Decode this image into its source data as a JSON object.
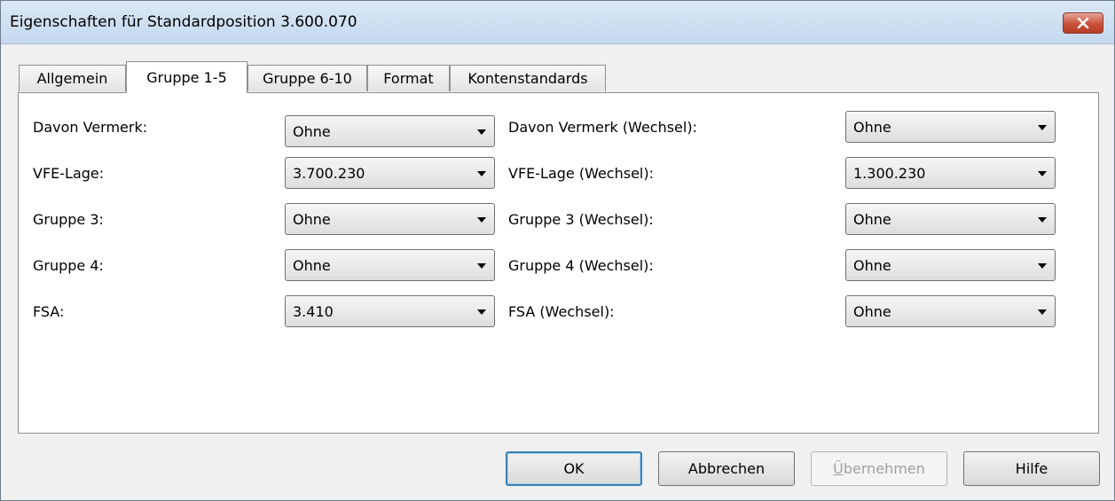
{
  "window": {
    "title": "Eigenschaften für Standardposition 3.600.070"
  },
  "tabs": [
    {
      "label": "Allgemein",
      "active": false
    },
    {
      "label": "Gruppe 1-5",
      "active": true
    },
    {
      "label": "Gruppe 6-10",
      "active": false
    },
    {
      "label": "Format",
      "active": false
    },
    {
      "label": "Kontenstandards",
      "active": false
    }
  ],
  "left_fields": [
    {
      "label": "Davon Vermerk:",
      "value": "Ohne"
    },
    {
      "label": "VFE-Lage:",
      "value": "3.700.230"
    },
    {
      "label": "Gruppe 3:",
      "value": "Ohne"
    },
    {
      "label": "Gruppe 4:",
      "value": "Ohne"
    },
    {
      "label": "FSA:",
      "value": "3.410"
    }
  ],
  "right_fields": [
    {
      "label": "Davon Vermerk (Wechsel):",
      "value": "Ohne"
    },
    {
      "label": "VFE-Lage (Wechsel):",
      "value": "1.300.230"
    },
    {
      "label": "Gruppe 3 (Wechsel):",
      "value": "Ohne"
    },
    {
      "label": "Gruppe 4 (Wechsel):",
      "value": "Ohne"
    },
    {
      "label": "FSA (Wechsel):",
      "value": "Ohne"
    }
  ],
  "buttons": {
    "ok": "OK",
    "cancel": "Abbrechen",
    "apply_prefix": "Ü",
    "apply_rest": "bernehmen",
    "help": "Hilfe"
  }
}
